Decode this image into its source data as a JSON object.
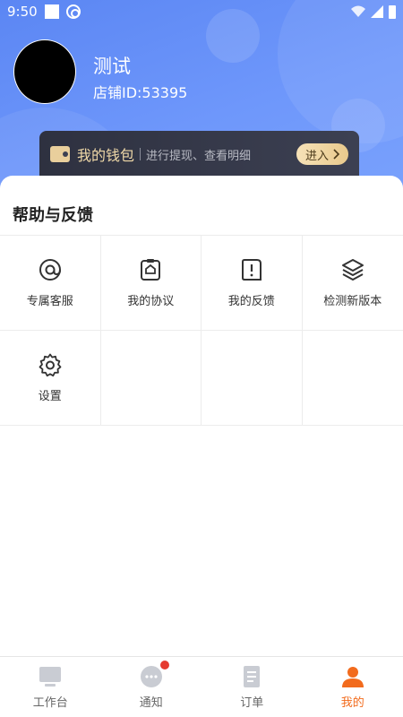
{
  "status_bar": {
    "time": "9:50"
  },
  "profile": {
    "name": "测试",
    "shop_id": "店铺ID:53395"
  },
  "wallet": {
    "title": "我的钱包",
    "subtitle": "进行提现、查看明细",
    "button": "进入"
  },
  "help": {
    "title": "帮助与反馈",
    "items": [
      {
        "label": "专属客服",
        "icon": "at-icon"
      },
      {
        "label": "我的协议",
        "icon": "agreement-icon"
      },
      {
        "label": "我的反馈",
        "icon": "feedback-icon"
      },
      {
        "label": "检测新版本",
        "icon": "layers-icon"
      },
      {
        "label": "设置",
        "icon": "gear-icon"
      }
    ]
  },
  "tabbar": {
    "items": [
      {
        "label": "工作台",
        "icon": "monitor-icon",
        "active": false
      },
      {
        "label": "通知",
        "icon": "chat-icon",
        "active": false,
        "badge": true
      },
      {
        "label": "订单",
        "icon": "document-icon",
        "active": false
      },
      {
        "label": "我的",
        "icon": "person-icon",
        "active": true
      }
    ]
  },
  "colors": {
    "header": "#6e97fb",
    "accent": "#f26b1d",
    "badge": "#e53a2f",
    "wallet_bg": "#3c4052",
    "wallet_gold": "#e9cf9c"
  }
}
